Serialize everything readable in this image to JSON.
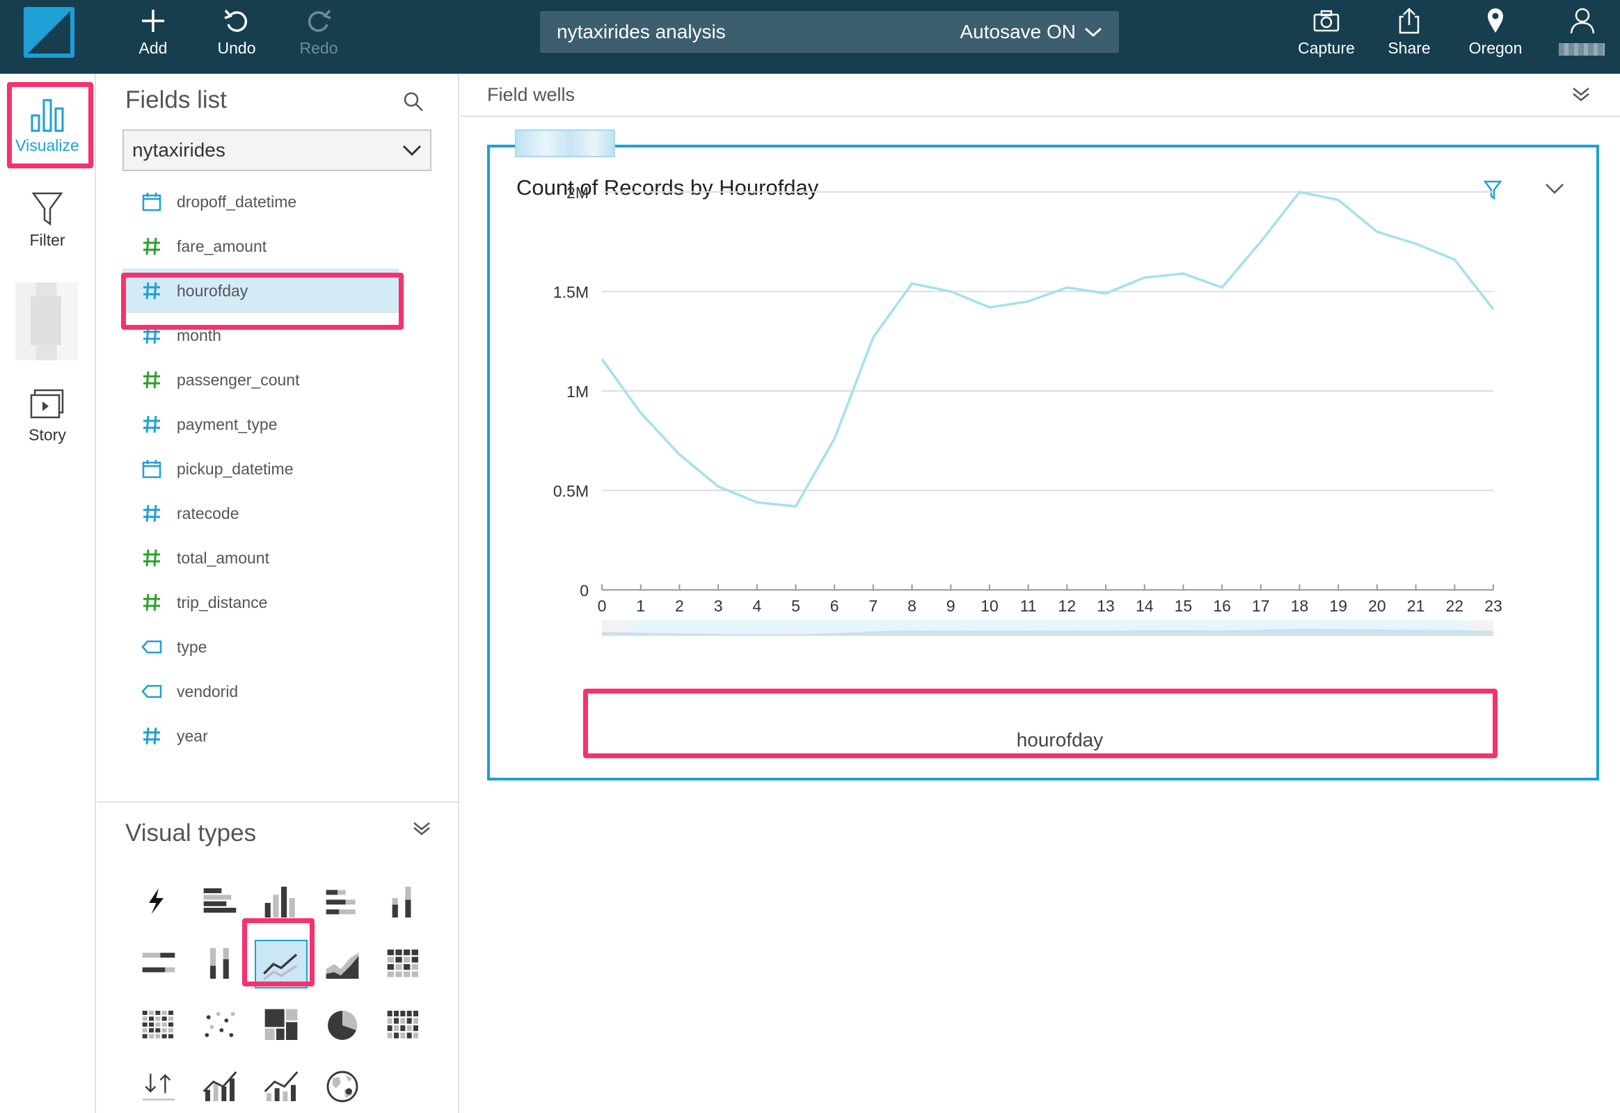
{
  "topbar": {
    "logo_icon": "quicksight-logo-icon",
    "add_label": "Add",
    "undo_label": "Undo",
    "redo_label": "Redo",
    "analysis_title": "nytaxirides analysis",
    "autosave_label": "Autosave ON",
    "capture_label": "Capture",
    "share_label": "Share",
    "region_label": "Oregon",
    "colors": {
      "bar": "#163e4f",
      "accent": "#1e9fd6",
      "highlight": "#f5326e"
    }
  },
  "rail": {
    "visualize_label": "Visualize",
    "filter_label": "Filter",
    "story_label": "Story"
  },
  "fields_panel": {
    "title": "Fields list",
    "dataset": "nytaxirides",
    "fields": [
      {
        "name": "dropoff_datetime",
        "type": "date",
        "selected": false
      },
      {
        "name": "fare_amount",
        "type": "measure",
        "selected": false
      },
      {
        "name": "hourofday",
        "type": "dimension-number",
        "selected": true
      },
      {
        "name": "month",
        "type": "dimension-number",
        "selected": false
      },
      {
        "name": "passenger_count",
        "type": "measure",
        "selected": false
      },
      {
        "name": "payment_type",
        "type": "dimension-number",
        "selected": false
      },
      {
        "name": "pickup_datetime",
        "type": "date",
        "selected": false
      },
      {
        "name": "ratecode",
        "type": "dimension-number",
        "selected": false
      },
      {
        "name": "total_amount",
        "type": "measure",
        "selected": false
      },
      {
        "name": "trip_distance",
        "type": "measure",
        "selected": false
      },
      {
        "name": "type",
        "type": "string",
        "selected": false
      },
      {
        "name": "vendorid",
        "type": "string",
        "selected": false
      },
      {
        "name": "year",
        "type": "dimension-number",
        "selected": false
      }
    ]
  },
  "visual_types": {
    "title": "Visual types",
    "types": [
      "autograph-icon",
      "horizontal-bar-icon",
      "vertical-bar-icon",
      "horizontal-stacked-bar-icon",
      "vertical-stacked-bar-icon",
      "horizontal-stacked-100-icon",
      "vertical-stacked-100-icon",
      "line-chart-icon",
      "area-line-icon",
      "pivot-table-icon",
      "heat-map-icon",
      "scatter-plot-icon",
      "tree-map-icon",
      "pie-chart-icon",
      "table-icon",
      "kpi-icon",
      "combo-bar-line-icon",
      "combo-stacked-line-icon",
      "geospatial-icon"
    ],
    "selected": "line-chart-icon"
  },
  "field_wells": {
    "label": "Field wells"
  },
  "visual": {
    "title": "Count of Records by Hourofday",
    "x_axis_title": "hourofday"
  },
  "chart_data": {
    "type": "line",
    "title": "Count of Records by Hourofday",
    "xlabel": "hourofday",
    "ylabel": "",
    "x": [
      0,
      1,
      2,
      3,
      4,
      5,
      6,
      7,
      8,
      9,
      10,
      11,
      12,
      13,
      14,
      15,
      16,
      17,
      18,
      19,
      20,
      21,
      22,
      23
    ],
    "series": [
      {
        "values": [
          1160000,
          890000,
          680000,
          520000,
          440000,
          420000,
          760000,
          1270000,
          1540000,
          1500000,
          1420000,
          1450000,
          1520000,
          1490000,
          1570000,
          1590000,
          1520000,
          1750000,
          2000000,
          1960000,
          1800000,
          1740000,
          1660000,
          1410000
        ]
      }
    ],
    "y_ticks": [
      "0",
      "0.5M",
      "1M",
      "1.5M",
      "2M"
    ],
    "ylim": [
      0,
      2000000
    ],
    "grid": true,
    "color": "#a6dff0"
  }
}
